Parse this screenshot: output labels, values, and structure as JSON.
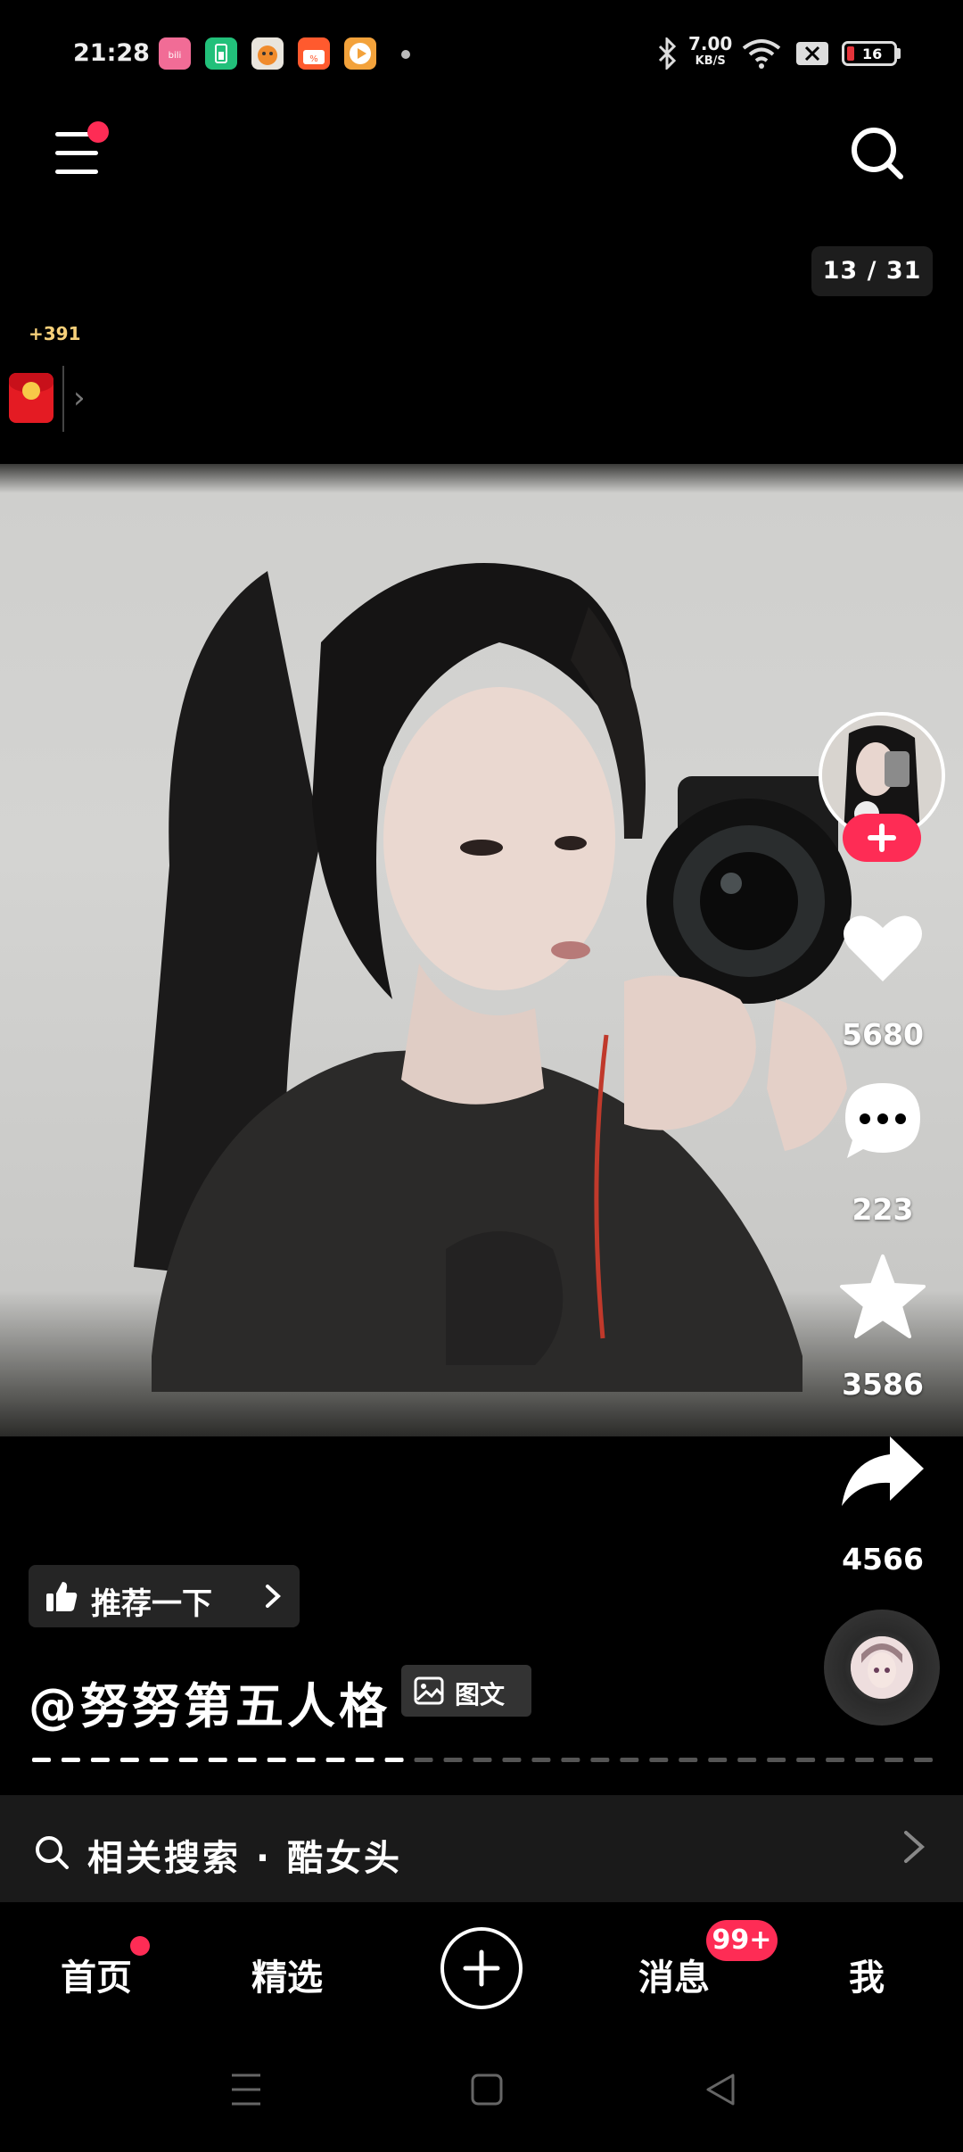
{
  "status_bar": {
    "time": "21:28",
    "apps": [
      {
        "icon": "bilibili-app-icon",
        "color": "#f16c96"
      },
      {
        "icon": "battery-app-icon",
        "color": "#22c07a"
      },
      {
        "icon": "game-app-icon",
        "color": "#e9e5dd"
      },
      {
        "icon": "shopping-app-icon",
        "color": "#ff5a2e"
      },
      {
        "icon": "video-app-icon",
        "color": "#f3a23b"
      }
    ],
    "net_speed_value": "7.00",
    "net_speed_unit": "KB/S",
    "battery_level": "16"
  },
  "header": {
    "page_counter": "13 / 31",
    "coins": "+391"
  },
  "post": {
    "likes": "5680",
    "comments": "223",
    "favorites": "3586",
    "shares": "4566",
    "recommend_label": "推荐一下",
    "author": "@努努第五人格",
    "type_tag": "图文",
    "progress": 0.42
  },
  "related_search": {
    "label": "相关搜索 · 酷女头"
  },
  "tab_bar": {
    "home": "首页",
    "featured": "精选",
    "messages": "消息",
    "messages_badge": "99+",
    "me": "我"
  },
  "colors": {
    "accent": "#fe2c55",
    "background": "#000000"
  }
}
